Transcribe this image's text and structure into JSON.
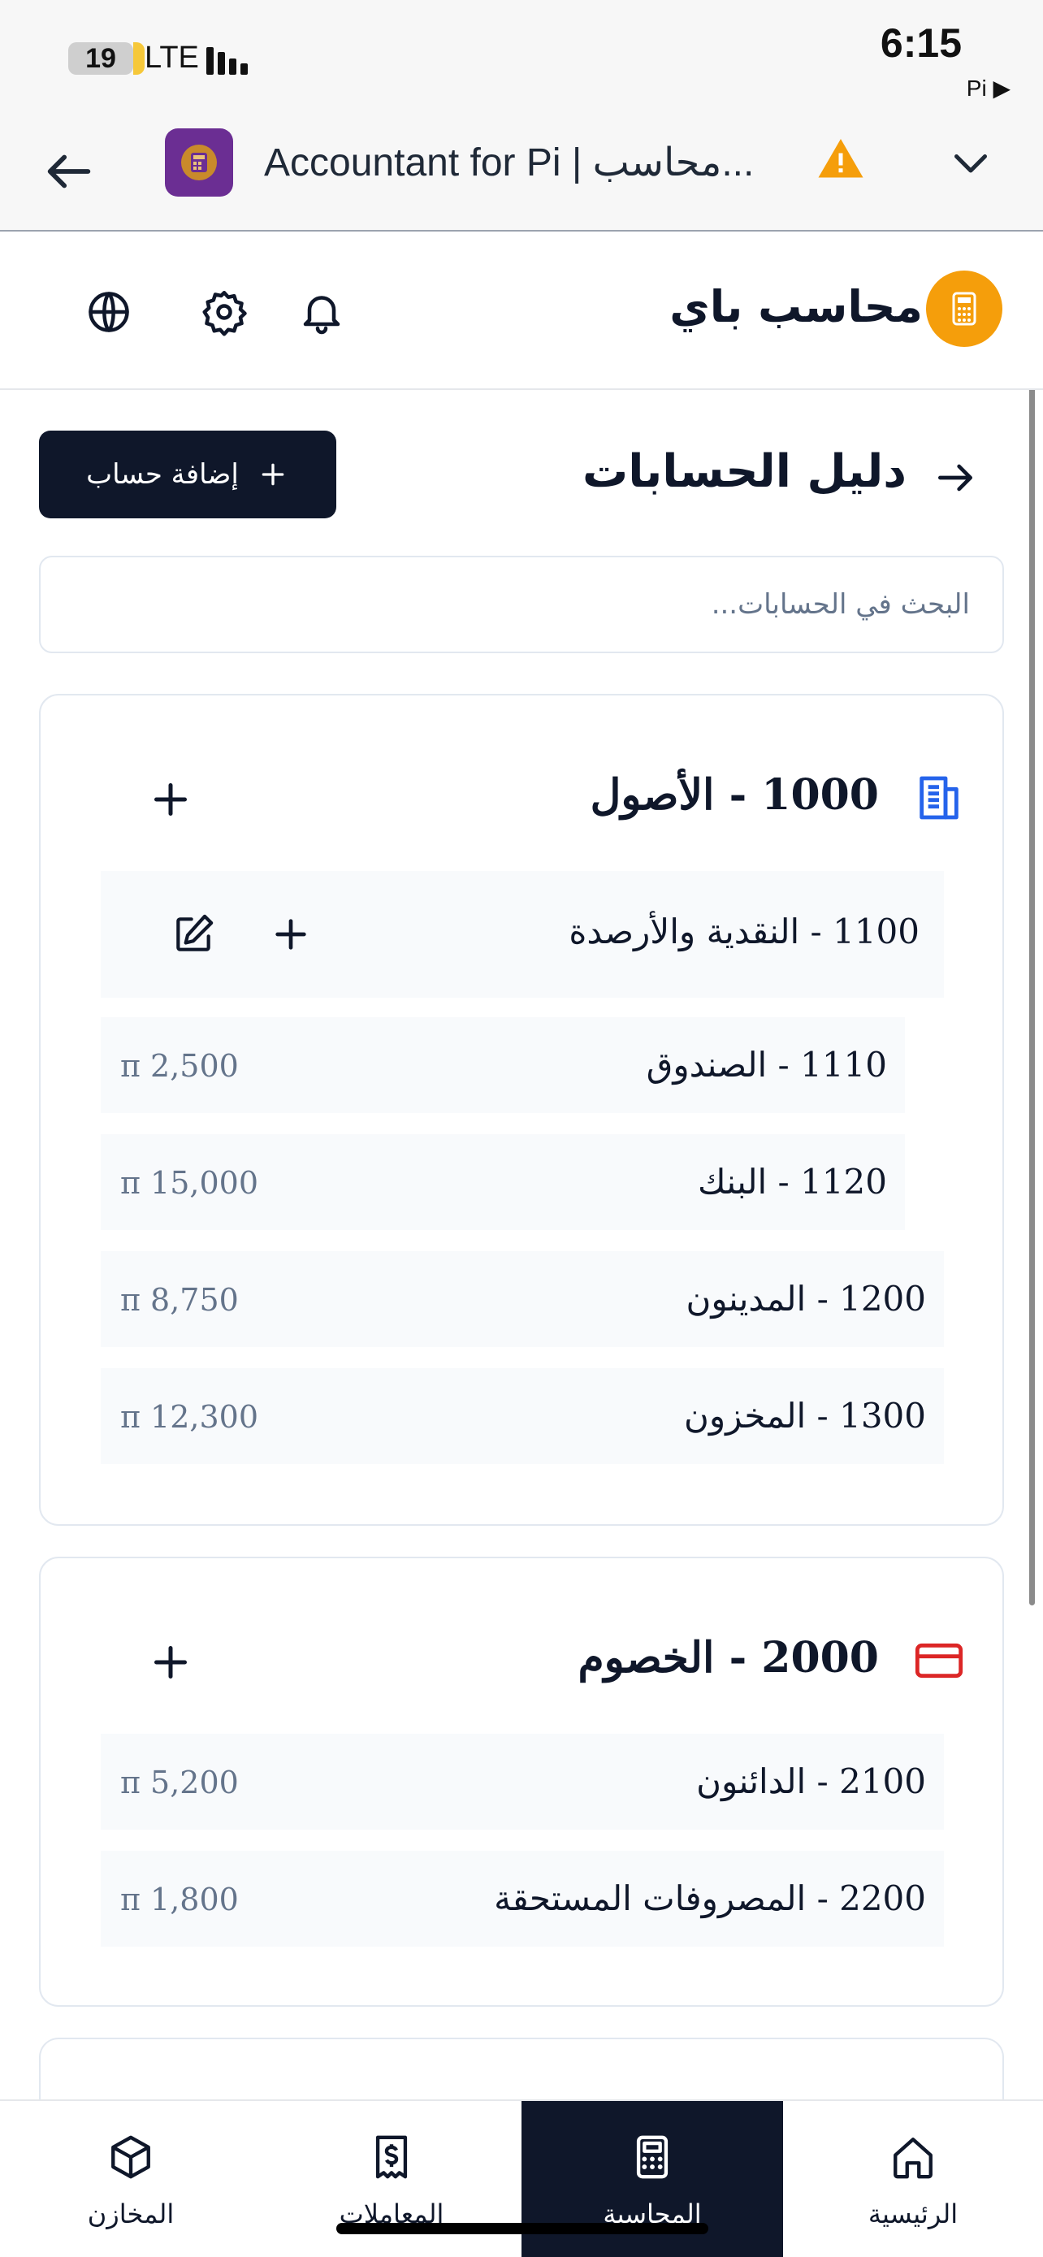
{
  "status_bar": {
    "battery": "19",
    "network": "LTE",
    "time": "6:15",
    "pi_indicator": "Pi ▶"
  },
  "browser": {
    "title": "Accountant for Pi | محاسب..."
  },
  "app": {
    "brand_name": "محاسب باي"
  },
  "page": {
    "title": "دليل الحسابات",
    "add_button": "إضافة حساب"
  },
  "search": {
    "placeholder": "البحث في الحسابات..."
  },
  "assets": {
    "heading": "1000 - الأصول",
    "group": {
      "label": "1100 - النقدية والأرصدة"
    },
    "rows": [
      {
        "label": "1110 - الصندوق",
        "amount": "π 2,500"
      },
      {
        "label": "1120 - البنك",
        "amount": "π 15,000"
      },
      {
        "label": "1200 - المدينون",
        "amount": "π 8,750"
      },
      {
        "label": "1300 - المخزون",
        "amount": "π 12,300"
      }
    ]
  },
  "liabilities": {
    "heading": "2000 - الخصوم",
    "rows": [
      {
        "label": "2100 - الدائنون",
        "amount": "π 5,200"
      },
      {
        "label": "2200 - المصروفات المستحقة",
        "amount": "π 1,800"
      }
    ]
  },
  "bottom_nav": [
    {
      "label": "المخازن",
      "icon": "package-icon",
      "active": false
    },
    {
      "label": "المعاملات",
      "icon": "receipt-icon",
      "active": false
    },
    {
      "label": "المحاسبة",
      "icon": "calculator-icon",
      "active": true
    },
    {
      "label": "الرئيسية",
      "icon": "home-icon",
      "active": false
    }
  ],
  "colors": {
    "primary": "#0f172a",
    "brand": "#f59e0b",
    "assets_icon": "#2563eb",
    "liabilities_icon": "#dc2626",
    "muted_text": "#64748b",
    "row_bg": "#f8fafc",
    "border": "#e2e8f0"
  }
}
